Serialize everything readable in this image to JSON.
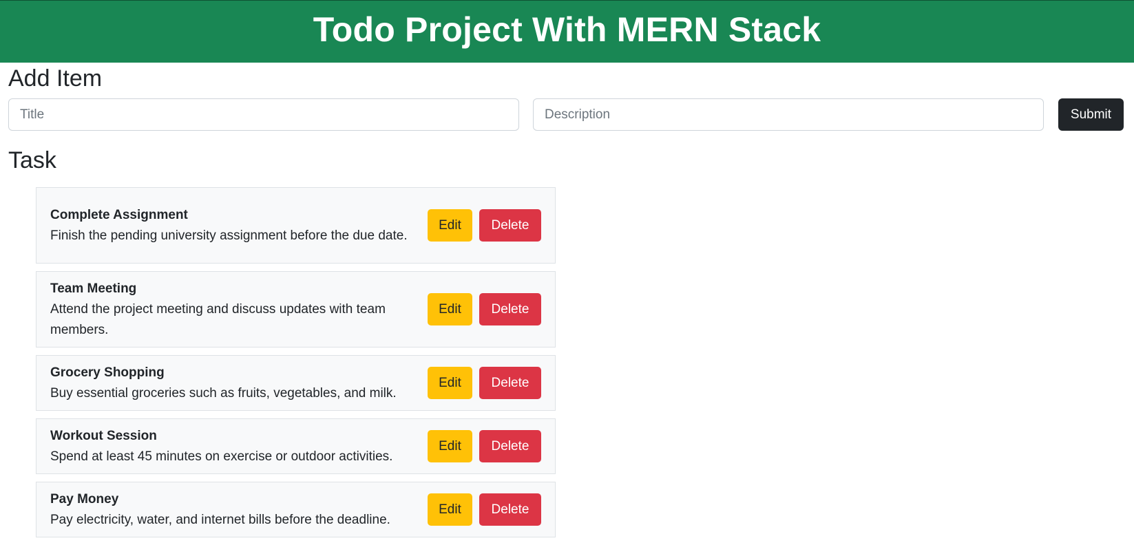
{
  "header": {
    "title": "Todo Project With MERN Stack"
  },
  "add_section": {
    "heading": "Add Item",
    "title_placeholder": "Title",
    "title_value": "",
    "description_placeholder": "Description",
    "description_value": "",
    "submit_label": "Submit"
  },
  "task_section": {
    "heading": "Task"
  },
  "tasks": [
    {
      "title": "Complete Assignment",
      "description": "Finish the pending university assignment before the due date.",
      "edit_label": "Edit",
      "delete_label": "Delete"
    },
    {
      "title": "Team Meeting",
      "description": "Attend the project meeting and discuss updates with team members.",
      "edit_label": "Edit",
      "delete_label": "Delete"
    },
    {
      "title": "Grocery Shopping",
      "description": "Buy essential groceries such as fruits, vegetables, and milk.",
      "edit_label": "Edit",
      "delete_label": "Delete"
    },
    {
      "title": "Workout Session",
      "description": "Spend at least 45 minutes on exercise or outdoor activities.",
      "edit_label": "Edit",
      "delete_label": "Delete"
    },
    {
      "title": "Pay Money",
      "description": "Pay electricity, water, and internet bills before the deadline.",
      "edit_label": "Edit",
      "delete_label": "Delete"
    }
  ],
  "colors": {
    "header_bg": "#198754",
    "submit_bg": "#212529",
    "edit_bg": "#ffc107",
    "delete_bg": "#dc3545",
    "task_bg": "#f8f9fa"
  }
}
